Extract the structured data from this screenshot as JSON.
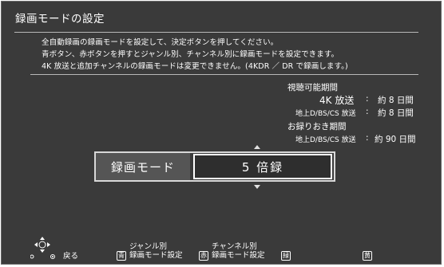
{
  "title": "録画モードの設定",
  "description": [
    "全自動録画の録画モードを設定して、決定ボタンを押してください。",
    "青ボタン、赤ボタンを押すとジャンル別、チャンネル別に録画モードを設定できます。",
    "4K 放送と追加チャンネルの録画モードは変更できません。(4KDR ／ DR で録画します。)"
  ],
  "viewable": {
    "heading": "視聴可能期間",
    "rows": [
      {
        "label": "4K 放送",
        "sep": ":",
        "value": "約 8 日間"
      },
      {
        "label": "地上D/BS/CS 放送",
        "sep": ":",
        "value": "約 8 日間"
      }
    ]
  },
  "keep": {
    "heading": "お録りおき期間",
    "rows": [
      {
        "label": "地上D/BS/CS 放送",
        "sep": ":",
        "value": "約 90 日間"
      }
    ]
  },
  "mode": {
    "label": "録画モード",
    "value": "5 倍録"
  },
  "footer": {
    "back": "戻る",
    "blue_key": "青",
    "blue_line1": "ジャンル別",
    "blue_line2": "録画モード設定",
    "red_key": "赤",
    "red_line1": "チャンネル別",
    "red_line2": "録画モード設定",
    "green_key": "緑",
    "yellow_key": "黄"
  },
  "colors": {
    "background": "#3a3a3a",
    "text": "#ffffff",
    "accent_border": "#ffffff"
  }
}
